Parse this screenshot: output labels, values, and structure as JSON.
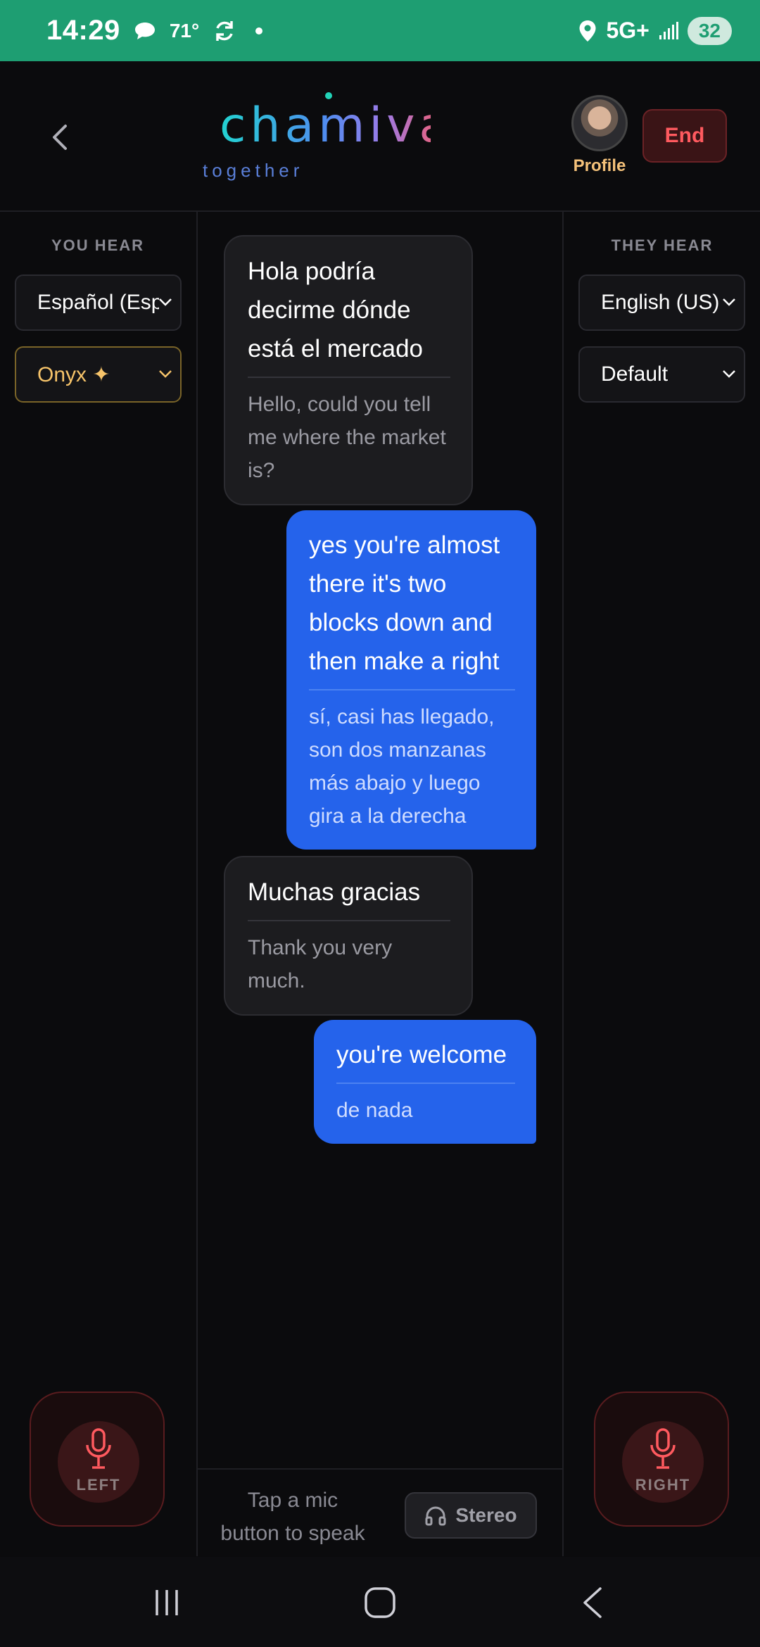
{
  "status_bar": {
    "time": "14:29",
    "temperature": "71°",
    "network": "5G+",
    "battery": "32"
  },
  "header": {
    "logo": "chamiva",
    "tagline": "together",
    "profile_label": "Profile",
    "end_label": "End"
  },
  "left_panel": {
    "label": "YOU HEAR",
    "language": "Español (España)",
    "voice": "Onyx ✦"
  },
  "right_panel": {
    "label": "THEY HEAR",
    "language": "English (US)",
    "voice": "Default"
  },
  "messages": [
    {
      "side": "left",
      "original": "Hola podría decirme dónde está el mercado",
      "translation": "Hello, could you tell me where the market is?"
    },
    {
      "side": "right",
      "original": "yes you're almost there it's two blocks down and then make a right",
      "translation": "sí, casi has llegado, son dos manzanas más abajo y luego gira a la derecha"
    },
    {
      "side": "left",
      "original": "Muchas gracias",
      "translation": "Thank you very much."
    },
    {
      "side": "right",
      "original": "you're welcome",
      "translation": "de nada"
    }
  ],
  "mic": {
    "left_label": "LEFT",
    "right_label": "RIGHT"
  },
  "footer": {
    "hint": "Tap a mic button to speak",
    "stereo_label": "Stereo"
  },
  "colors": {
    "status_bar": "#1e9e72",
    "accent_blue": "#2563eb",
    "danger_red": "#ff5a5f",
    "onyx_gold": "#f7c46a"
  }
}
